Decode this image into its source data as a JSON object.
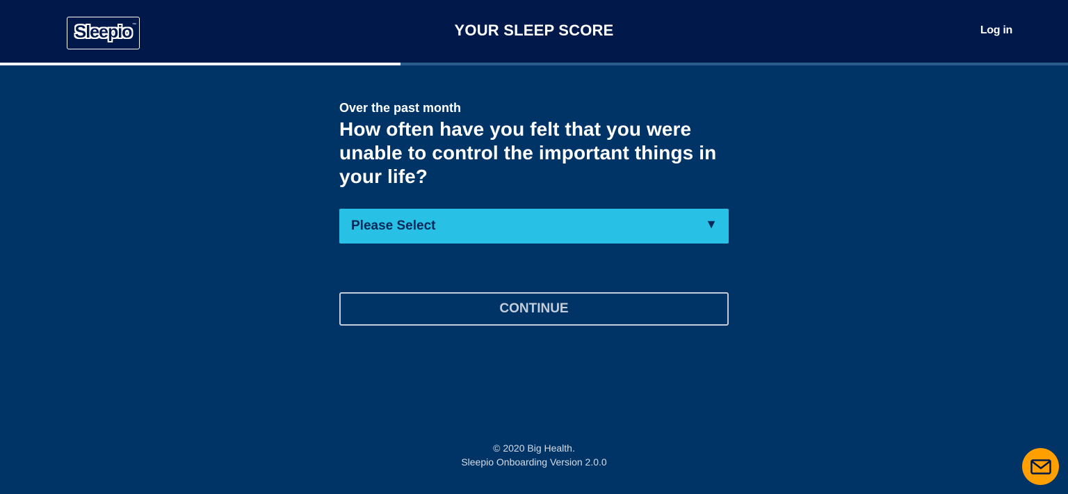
{
  "header": {
    "logo_text": "Sleepio",
    "logo_tm": "™",
    "title": "YOUR SLEEP SCORE",
    "login_label": "Log in"
  },
  "progress": {
    "fraction": 0.375
  },
  "question": {
    "subheading": "Over the past month",
    "text": "How often have you felt that you were unable to control the important things in your life?"
  },
  "select": {
    "value": "Please Select",
    "arrow": "▼"
  },
  "actions": {
    "continue_label": "CONTINUE"
  },
  "footer": {
    "copyright": "© 2020 Big Health.",
    "version": "Sleepio Onboarding Version 2.0.0"
  },
  "chat": {
    "icon": "envelope-icon"
  },
  "colors": {
    "background": "#003366",
    "header": "#01184a",
    "select_accent": "#29c0e6",
    "chat_button": "#ff9f00"
  }
}
